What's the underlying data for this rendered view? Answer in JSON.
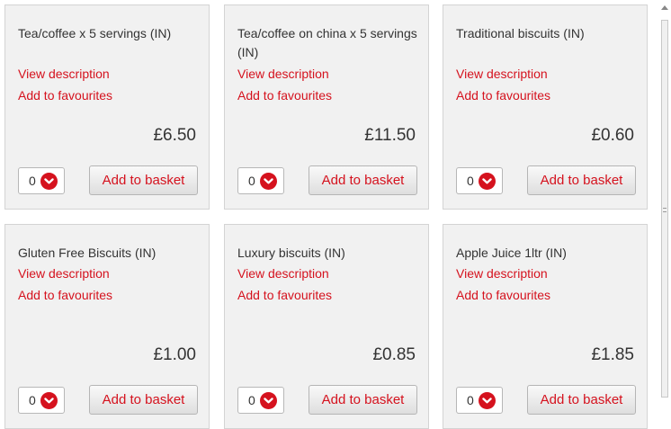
{
  "products": [
    {
      "name": "Tea/coffee x 5 servings (IN)",
      "view_description": "View description",
      "add_to_favourites": "Add to favourites",
      "price": "£6.50",
      "quantity": "0",
      "add_to_basket": "Add to basket"
    },
    {
      "name": "Tea/coffee on china x 5 servings (IN)",
      "view_description": "View description",
      "add_to_favourites": "Add to favourites",
      "price": "£11.50",
      "quantity": "0",
      "add_to_basket": "Add to basket"
    },
    {
      "name": "Traditional biscuits (IN)",
      "view_description": "View description",
      "add_to_favourites": "Add to favourites",
      "price": "£0.60",
      "quantity": "0",
      "add_to_basket": "Add to basket"
    },
    {
      "name": "Gluten Free Biscuits (IN)",
      "view_description": "View description",
      "add_to_favourites": "Add to favourites",
      "price": "£1.00",
      "quantity": "0",
      "add_to_basket": "Add to basket"
    },
    {
      "name": "Luxury biscuits (IN)",
      "view_description": "View description",
      "add_to_favourites": "Add to favourites",
      "price": "£0.85",
      "quantity": "0",
      "add_to_basket": "Add to basket"
    },
    {
      "name": "Apple Juice 1ltr (IN)",
      "view_description": "View description",
      "add_to_favourites": "Add to favourites",
      "price": "£1.85",
      "quantity": "0",
      "add_to_basket": "Add to basket"
    }
  ],
  "icons": {
    "quantity_dropdown": "chevron-down-icon",
    "scroll_up": "arrow-up-icon"
  },
  "colors": {
    "accent": "#d5121e",
    "card_background": "#f1f1f1",
    "text": "#333333"
  }
}
